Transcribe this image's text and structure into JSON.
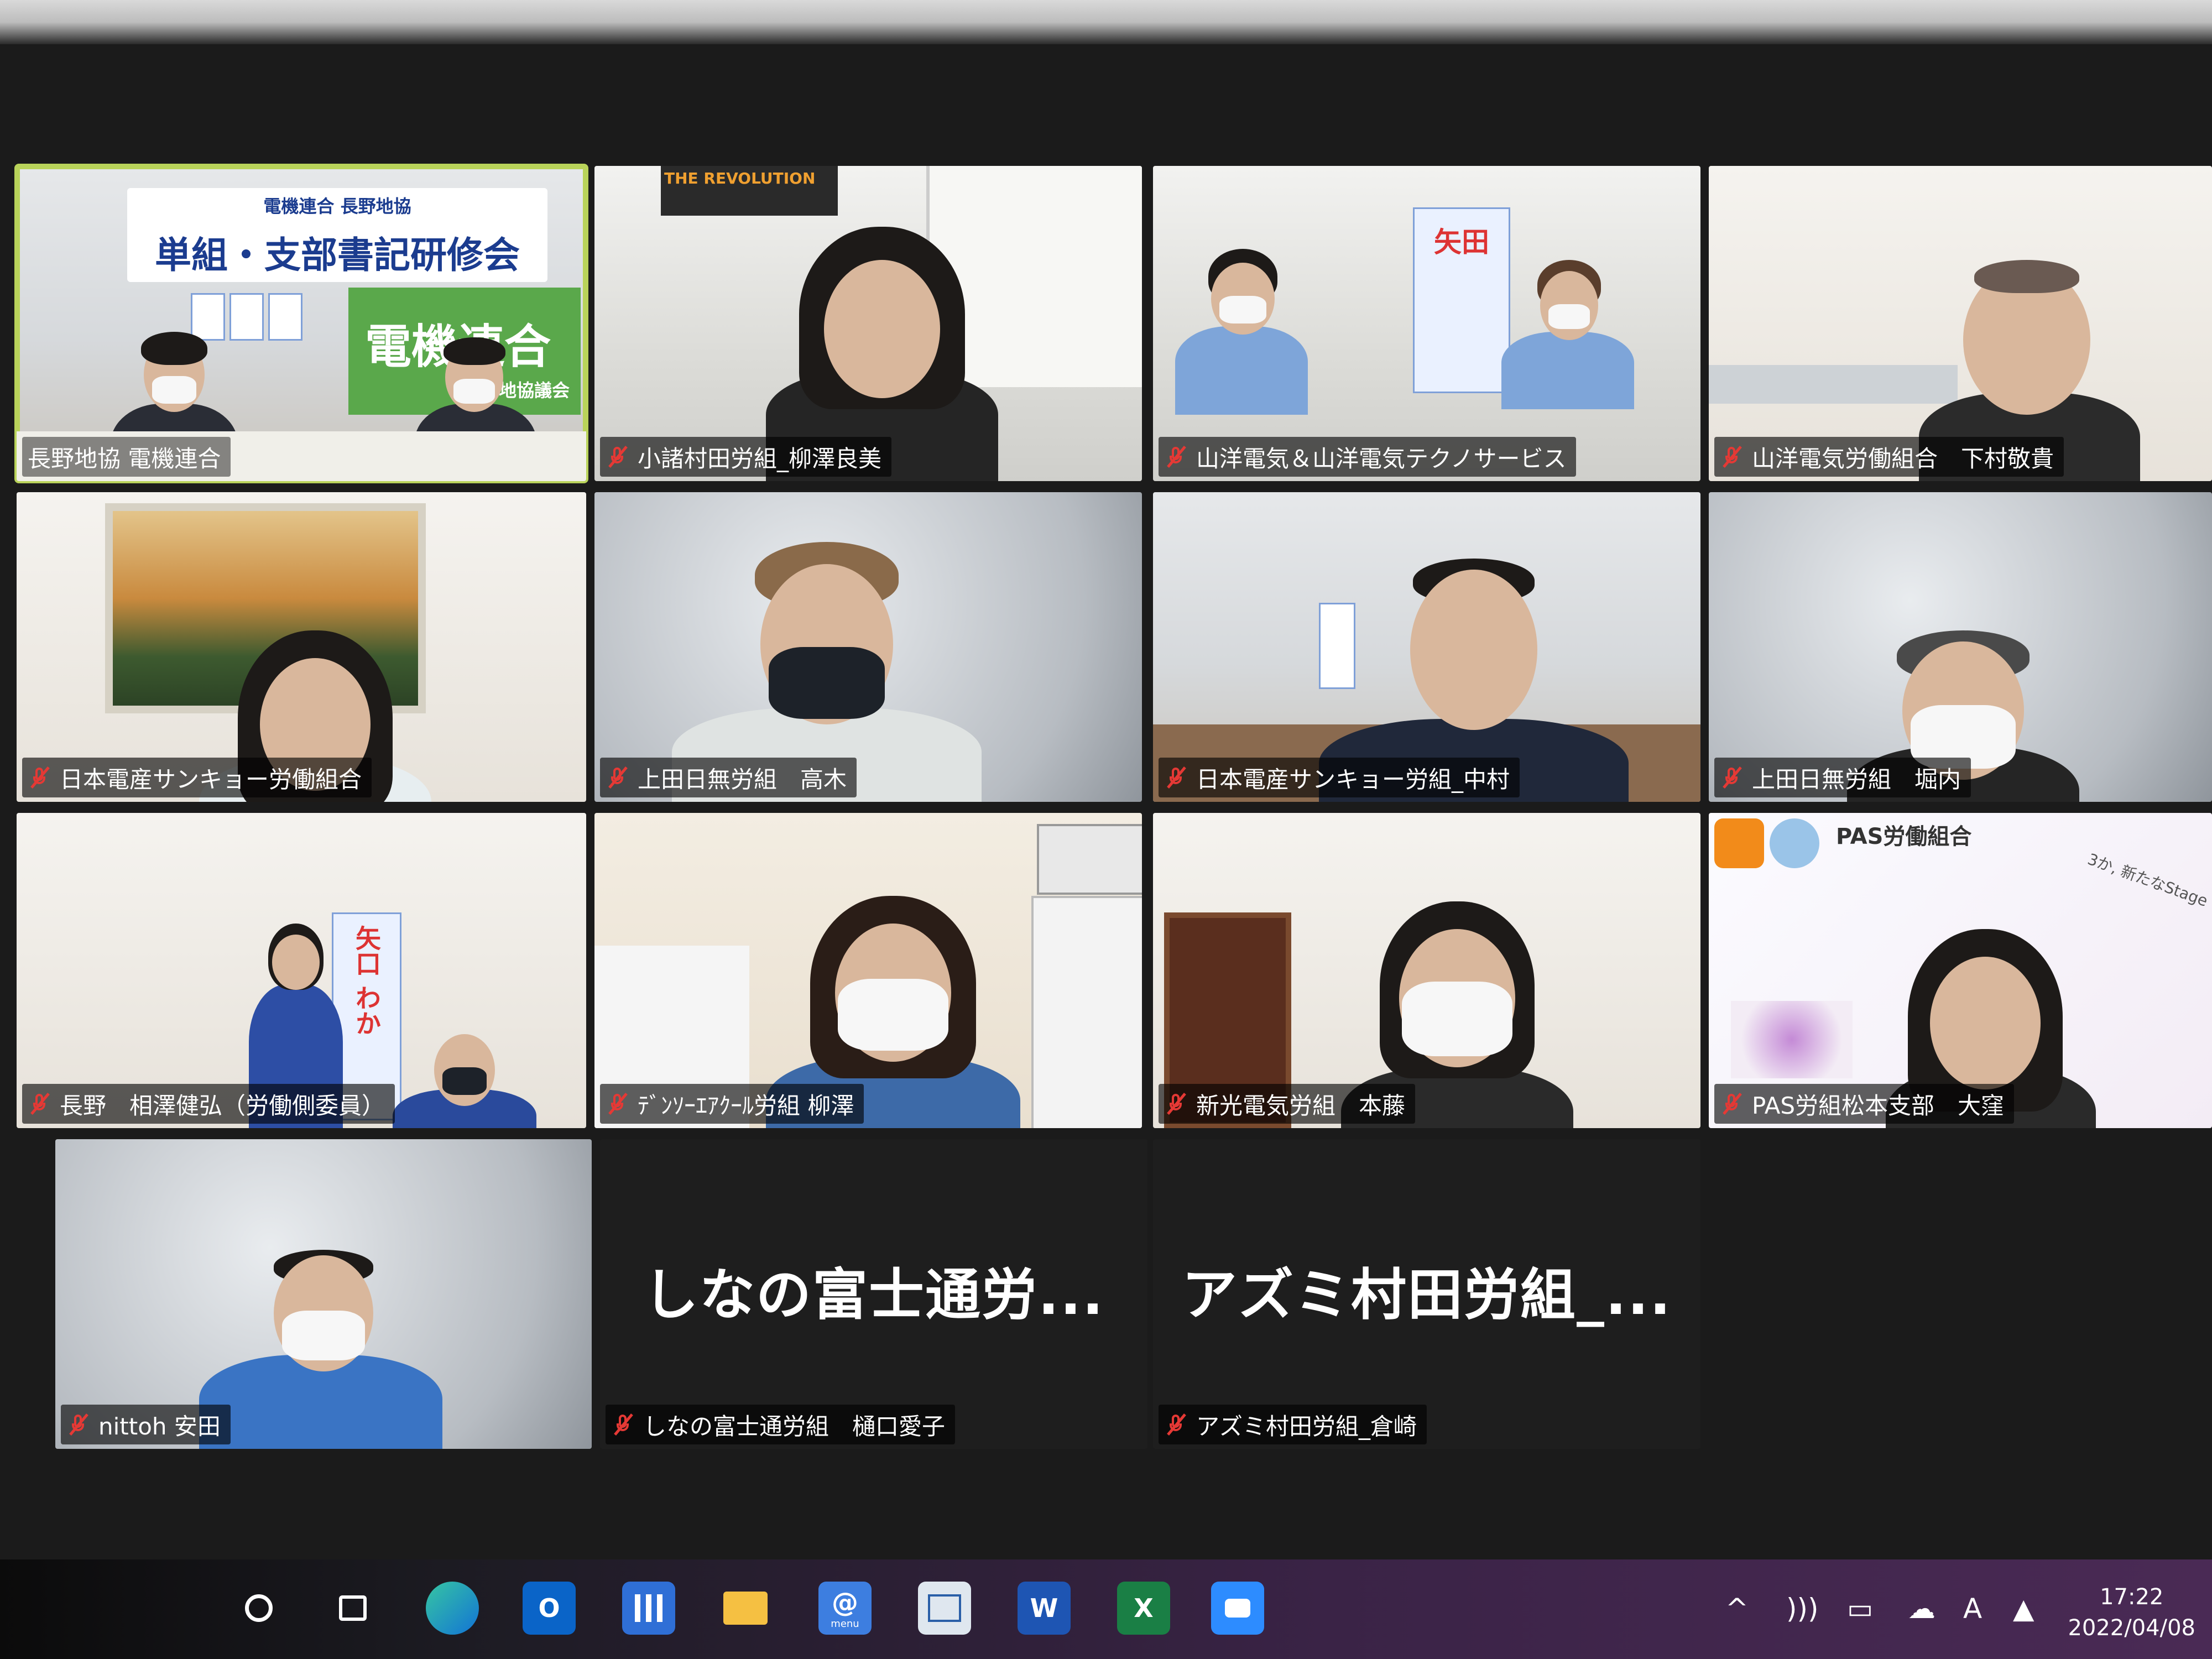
{
  "tiles": [
    {
      "name": "長野地協 電機連合",
      "muted": false,
      "active": true
    },
    {
      "name": "小諸村田労組_柳澤良美",
      "muted": true
    },
    {
      "name": "山洋電気＆山洋電気テクノサービス",
      "muted": true
    },
    {
      "name": "山洋電気労働組合　下村敬貴",
      "muted": true
    },
    {
      "name": "日本電産サンキョー労働組合",
      "muted": true
    },
    {
      "name": "上田日無労組　高木",
      "muted": true
    },
    {
      "name": "日本電産サンキョー労組_中村",
      "muted": true
    },
    {
      "name": "上田日無労組　堀内",
      "muted": true
    },
    {
      "name": "長野　相澤健弘（労働側委員）",
      "muted": true
    },
    {
      "name": "ﾃﾞﾝｿｰｴｱｸｰﾙ労組 柳澤",
      "muted": true
    },
    {
      "name": "新光電気労組　本藤",
      "muted": true
    },
    {
      "name": "PAS労組松本支部　大窪",
      "muted": true
    },
    {
      "name": "nittoh 安田",
      "muted": true
    },
    {
      "name": "しなの富士通労組　樋口愛子",
      "muted": true,
      "display": "しなの富士通労..."
    },
    {
      "name": "アズミ村田労組_倉崎",
      "muted": true,
      "display": "アズミ村田労組_..."
    }
  ],
  "backgrounds": {
    "meeting_banner_small": "電機連合 長野地協",
    "meeting_banner": "単組・支部書記研修会",
    "green_banner": "電機連合",
    "green_banner_sub": "長野地協議会",
    "revolution_poster": "THE REVOLUTION",
    "pas_logo": "PAS労働組合",
    "pas_tagline": "3か, 新たなStage",
    "candidate_poster_a": "矢田",
    "candidate_poster_b": "矢口 わか"
  },
  "taskbar": {
    "icons": [
      "start-icon",
      "task-view-icon",
      "edge-icon",
      "outlook-icon",
      "app-grid-icon",
      "file-explorer-icon",
      "mail-menu-icon",
      "widget-icon",
      "word-icon",
      "excel-icon",
      "zoom-icon"
    ],
    "mail_label": "menu",
    "word_label": "W",
    "excel_label": "X",
    "outlook_label": "O",
    "time": "17:22",
    "date": "2022/04/08"
  },
  "colors": {
    "active_outline": "#b9d35a",
    "muted_icon": "#e53935",
    "taskbar_accent": "#4a2a55"
  }
}
